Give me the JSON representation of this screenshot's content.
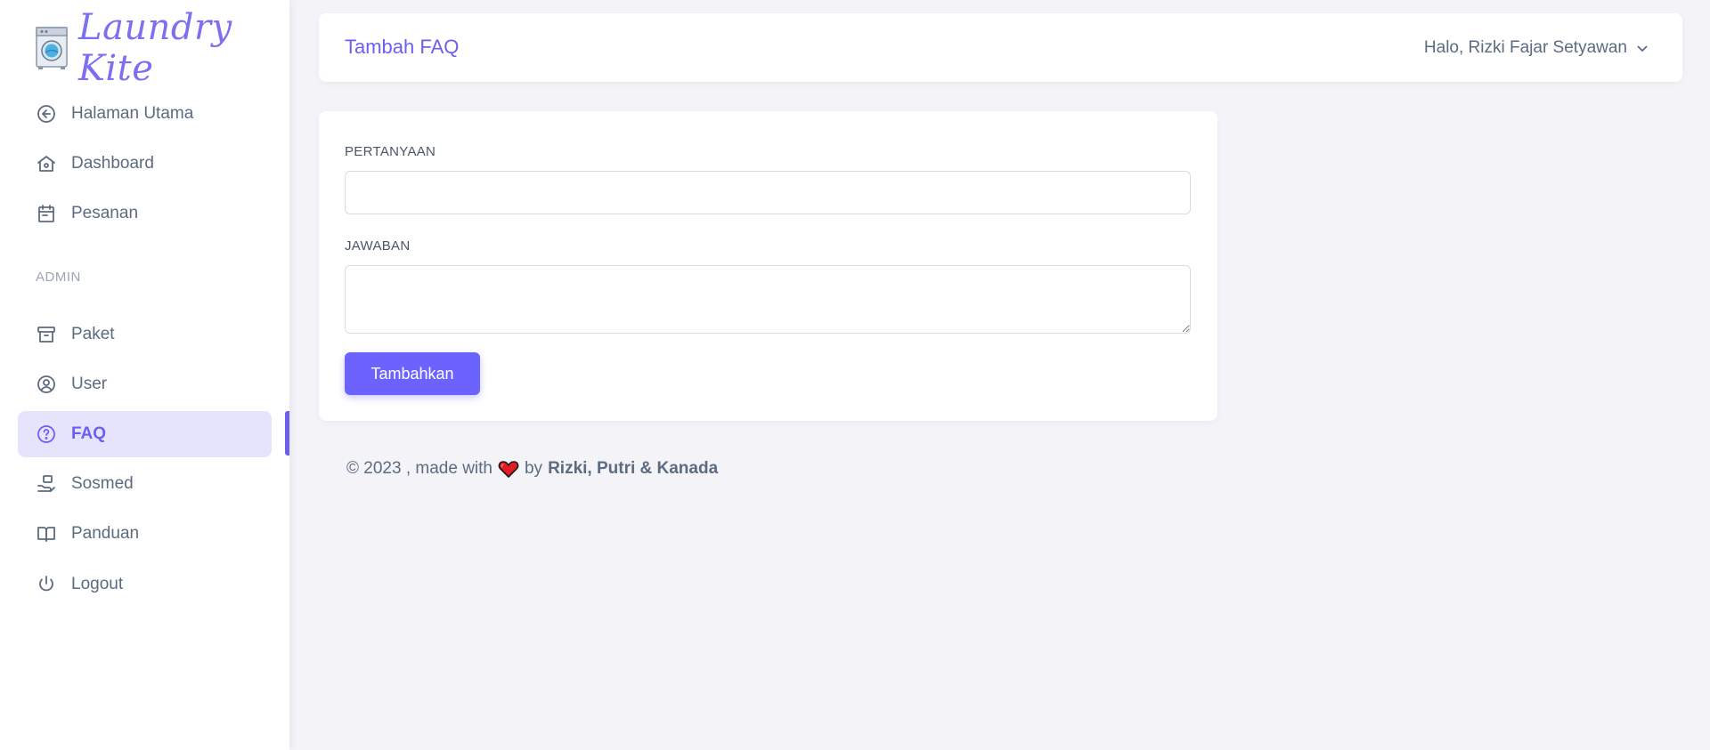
{
  "brand": {
    "name": "Laundry Kite",
    "logo_icon": "washing-machine-icon"
  },
  "sidebar": {
    "items": [
      {
        "label": "Halaman Utama",
        "icon": "arrow-left-circle-icon"
      },
      {
        "label": "Dashboard",
        "icon": "home-icon"
      },
      {
        "label": "Pesanan",
        "icon": "calendar-icon"
      }
    ],
    "section_label": "ADMIN",
    "admin_items": [
      {
        "label": "Paket",
        "icon": "archive-icon"
      },
      {
        "label": "User",
        "icon": "user-circle-icon"
      },
      {
        "label": "FAQ",
        "icon": "question-circle-icon",
        "active": true
      },
      {
        "label": "Sosmed",
        "icon": "hand-share-icon"
      },
      {
        "label": "Panduan",
        "icon": "book-open-icon"
      },
      {
        "label": "Logout",
        "icon": "power-icon"
      }
    ]
  },
  "header": {
    "title": "Tambah FAQ",
    "user_greeting": "Halo, Rizki Fajar Setyawan"
  },
  "form": {
    "question_label": "PERTANYAAN",
    "question_value": "",
    "answer_label": "JAWABAN",
    "answer_value": "",
    "submit_label": "Tambahkan"
  },
  "footer": {
    "prefix": "© 2023 , made with",
    "by": "by",
    "authors": "Rizki, Putri & Kanada"
  },
  "colors": {
    "accent": "#6c5ff0",
    "button": "#6c63ff",
    "active_bg": "#e6e4fd",
    "page_bg": "#f3f3f8"
  }
}
